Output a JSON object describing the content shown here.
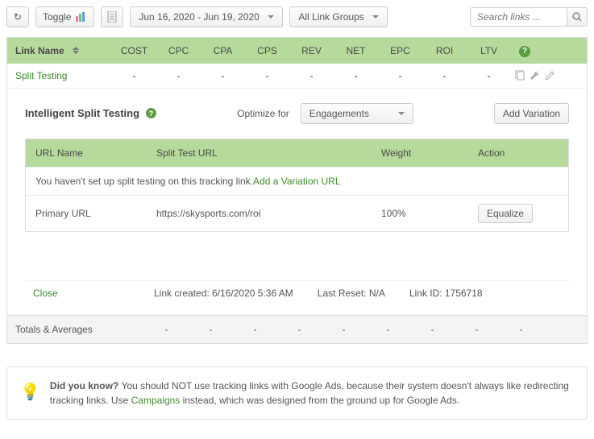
{
  "toolbar": {
    "toggle_label": "Toggle",
    "date_range": "Jun 16, 2020 - Jun 19, 2020",
    "link_groups": "All Link Groups",
    "search_placeholder": "Search links ..."
  },
  "headers": {
    "link_name": "Link Name",
    "cost": "COST",
    "cpc": "CPC",
    "cpa": "CPA",
    "cps": "CPS",
    "rev": "REV",
    "net": "NET",
    "epc": "EPC",
    "roi": "ROI",
    "ltv": "LTV"
  },
  "row": {
    "link_name": "Split Testing",
    "cost": "-",
    "cpc": "-",
    "cpa": "-",
    "cps": "-",
    "rev": "-",
    "net": "-",
    "epc": "-",
    "roi": "-",
    "ltv": "-"
  },
  "detail": {
    "title": "Intelligent Split Testing",
    "optimize_for": "Optimize for",
    "optimize_value": "Engagements",
    "add_variation": "Add Variation",
    "inner_headers": {
      "url_name": "URL Name",
      "split_test_url": "Split Test URL",
      "weight": "Weight",
      "action": "Action"
    },
    "empty_msg": "You haven't set up split testing on this tracking link. ",
    "add_variation_link": "Add a Variation URL",
    "primary": {
      "name": "Primary URL",
      "url": "https://skysports.com/roi",
      "weight": "100%",
      "action": "Equalize"
    }
  },
  "footer": {
    "close": "Close",
    "created": "Link created: 6/16/2020 5:36 AM",
    "last_reset": "Last Reset: N/A",
    "link_id": "Link ID: 1756718"
  },
  "totals": {
    "label": "Totals & Averages",
    "vals": [
      "-",
      "-",
      "-",
      "-",
      "-",
      "-",
      "-",
      "-",
      "-"
    ]
  },
  "tip": {
    "title": "Did you know? ",
    "body1": "You should NOT use tracking links with Google Ads, because their system doesn't always like redirecting tracking links. Use ",
    "campaigns_link": "Campaigns",
    "body2": " instead, which was designed from the ground up for Google Ads."
  }
}
